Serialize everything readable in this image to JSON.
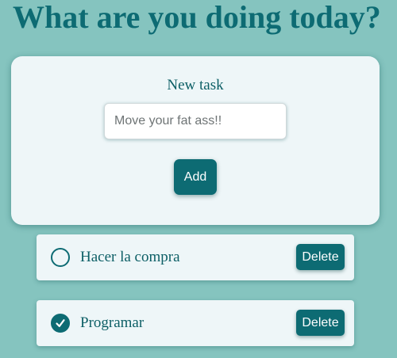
{
  "header": {
    "title": "What are you doing today?"
  },
  "form": {
    "label": "New task",
    "input_placeholder": "Move your fat ass!!",
    "input_value": "",
    "add_label": "Add"
  },
  "tasks": [
    {
      "label": "Hacer la compra",
      "completed": false,
      "delete_label": "Delete",
      "check_icon": "empty-circle-icon"
    },
    {
      "label": "Programar",
      "completed": true,
      "delete_label": "Delete",
      "check_icon": "checkmark-circle-icon"
    }
  ],
  "colors": {
    "background": "#85c4bf",
    "accent": "#0d6b73",
    "card": "#eef6f8"
  }
}
